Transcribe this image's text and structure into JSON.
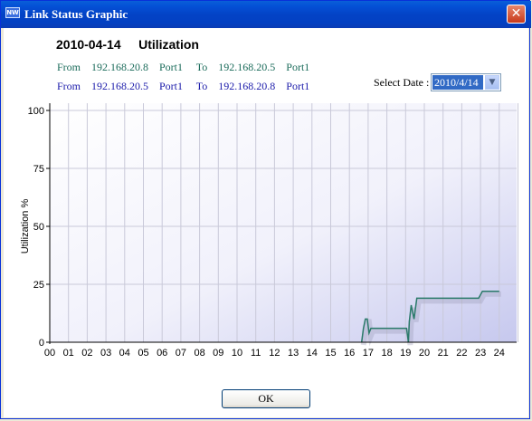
{
  "window": {
    "title": "Link Status Graphic",
    "icon": "network-icon",
    "close_label": "✕"
  },
  "chart_title": {
    "date": "2010-04-14",
    "metric": "Utilization"
  },
  "routes": [
    {
      "text": "From    192.168.20.8    Port1     To    192.168.20.5    Port1",
      "color": "#1a6b5a"
    },
    {
      "text": "From    192.168.20.5    Port1     To    192.168.20.8    Port1",
      "color": "#1a1aaa"
    }
  ],
  "select_date": {
    "label": "Select Date :",
    "value": "2010/4/14"
  },
  "ok_label": "OK",
  "chart_data": {
    "type": "line",
    "title": "",
    "xlabel": "",
    "ylabel": "Utilization %",
    "ylim": [
      0,
      100
    ],
    "xlim": [
      0,
      25
    ],
    "grid": true,
    "yticks": [
      0,
      25,
      50,
      75,
      100
    ],
    "xtick_labels": [
      "00",
      "01",
      "02",
      "03",
      "04",
      "05",
      "06",
      "07",
      "08",
      "09",
      "10",
      "11",
      "12",
      "13",
      "14",
      "15",
      "16",
      "17",
      "18",
      "19",
      "20",
      "21",
      "22",
      "23",
      "24"
    ],
    "series": [
      {
        "color": "#2a7a6a",
        "x": [
          16.65,
          16.75,
          16.85,
          16.95,
          17.05,
          17.15,
          17.25,
          19.05,
          19.1,
          19.15,
          19.2,
          19.3,
          19.45,
          19.6,
          19.7,
          22.9,
          23.1,
          24.0
        ],
        "y": [
          0,
          6,
          10,
          10,
          4,
          6,
          6,
          6,
          3,
          0,
          9,
          16,
          10,
          19,
          19,
          19,
          22,
          22
        ]
      }
    ]
  }
}
